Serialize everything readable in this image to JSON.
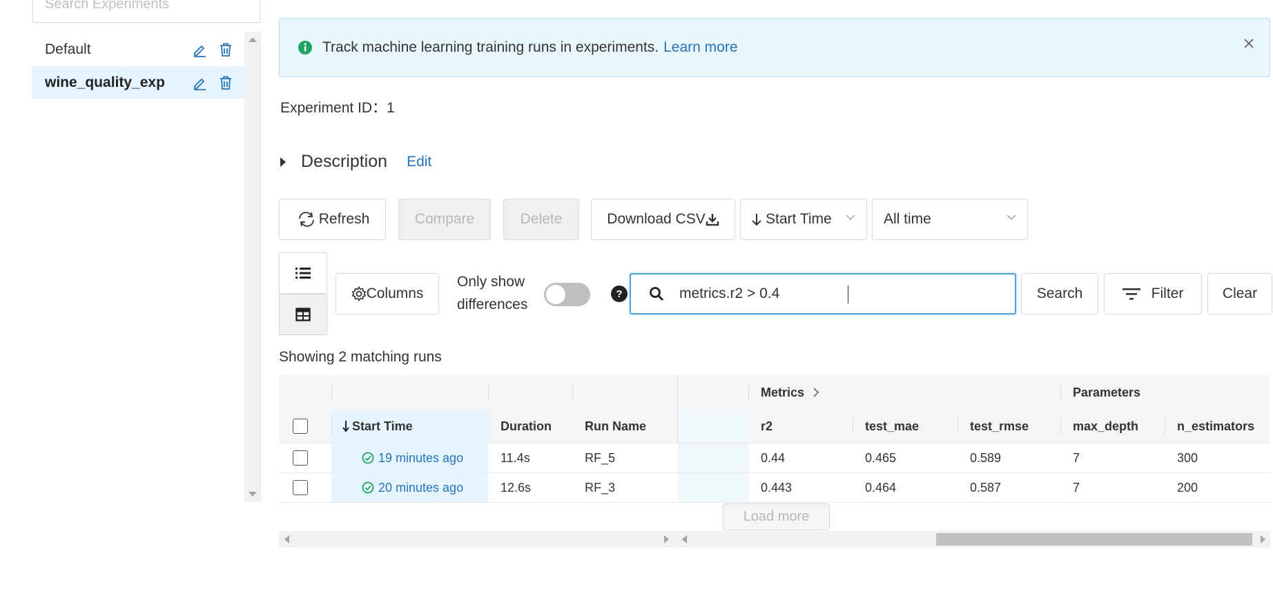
{
  "sidebar": {
    "search_placeholder": "Search Experiments",
    "experiments": [
      {
        "name": "Default",
        "active": false
      },
      {
        "name": "wine_quality_exp",
        "active": true
      }
    ]
  },
  "banner": {
    "text": "Track machine learning training runs in experiments.",
    "link": "Learn more"
  },
  "experiment": {
    "id_label": "Experiment ID：",
    "id_value": "1",
    "description_label": "Description",
    "edit_label": "Edit"
  },
  "toolbar": {
    "refresh": "Refresh",
    "compare": "Compare",
    "delete": "Delete",
    "download_csv": "Download CSV",
    "sort_by": "Start Time",
    "time_range": "All time"
  },
  "filters": {
    "columns": "Columns",
    "only_show_differences": "Only show differences",
    "query": "metrics.r2 > 0.4",
    "search": "Search",
    "filter": "Filter",
    "clear": "Clear"
  },
  "results": {
    "count_text": "Showing 2 matching runs"
  },
  "table": {
    "group_headers": {
      "metrics": "Metrics",
      "parameters": "Parameters"
    },
    "columns": {
      "start_time": "Start Time",
      "duration": "Duration",
      "run_name": "Run Name",
      "r2": "r2",
      "test_mae": "test_mae",
      "test_rmse": "test_rmse",
      "max_depth": "max_depth",
      "n_estimators": "n_estimators"
    },
    "rows": [
      {
        "start_time": "19 minutes ago",
        "duration": "11.4s",
        "run_name": "RF_5",
        "r2": "0.44",
        "test_mae": "0.465",
        "test_rmse": "0.589",
        "max_depth": "7",
        "n_estimators": "300"
      },
      {
        "start_time": "20 minutes ago",
        "duration": "12.6s",
        "run_name": "RF_3",
        "r2": "0.443",
        "test_mae": "0.464",
        "test_rmse": "0.587",
        "max_depth": "7",
        "n_estimators": "200"
      }
    ],
    "load_more": "Load more"
  },
  "colors": {
    "accent": "#2374bb",
    "success": "#21a366",
    "banner_bg": "#e9f7fc",
    "selected_bg": "#e6f4ff"
  }
}
